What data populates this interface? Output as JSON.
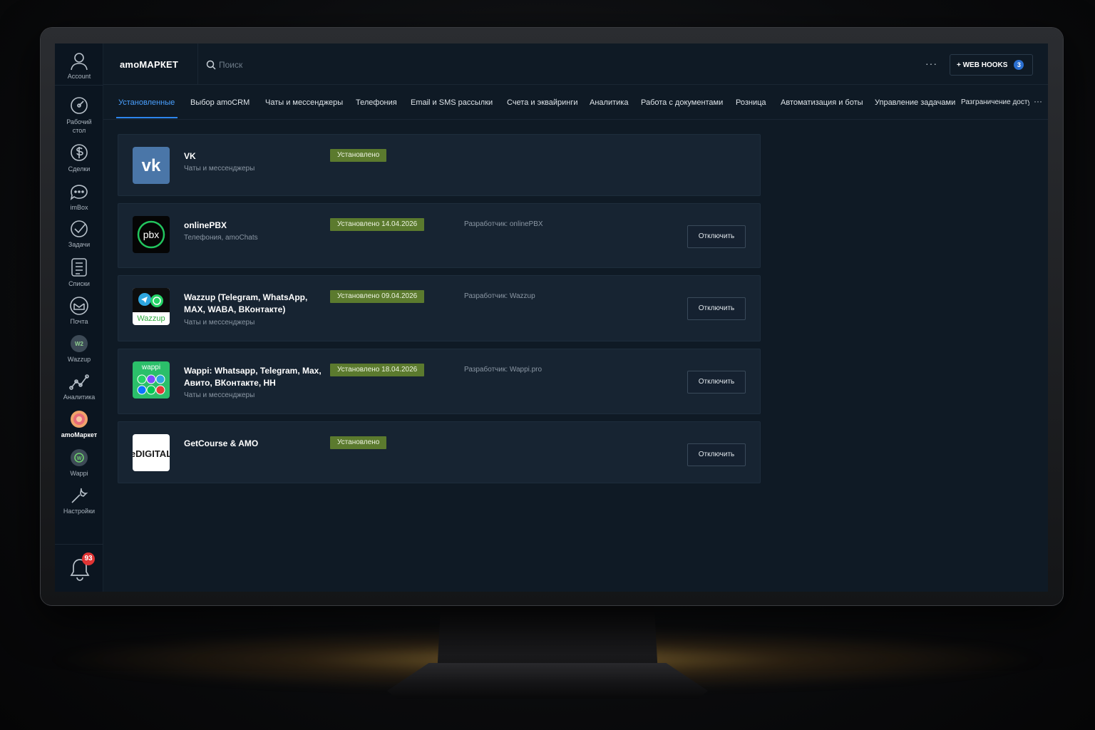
{
  "app": {
    "title": "amoМАРКЕТ",
    "search_placeholder": "Поиск",
    "more": "···",
    "webhooks_label": "+ WEB HOOKS",
    "webhooks_count": "3"
  },
  "sidebar": {
    "account": "Account",
    "items": [
      {
        "label": "Рабочий стол",
        "icon": "dashboard-gauge-icon"
      },
      {
        "label": "Сделки",
        "icon": "deals-dollar-icon"
      },
      {
        "label": "imBox",
        "icon": "chat-bubble-icon"
      },
      {
        "label": "Задачи",
        "icon": "tasks-check-icon"
      },
      {
        "label": "Списки",
        "icon": "lists-icon"
      },
      {
        "label": "Почта",
        "icon": "mail-icon"
      },
      {
        "label": "Wazzup",
        "icon": "wazzup-icon"
      },
      {
        "label": "Аналитика",
        "icon": "analytics-icon"
      },
      {
        "label": "amoМаркет",
        "icon": "amomarket-icon"
      },
      {
        "label": "Wappi",
        "icon": "wappi-icon"
      },
      {
        "label": "Настройки",
        "icon": "settings-wrench-icon"
      }
    ],
    "notifications_count": "93"
  },
  "tabs": [
    {
      "label": "Установленные",
      "active": true
    },
    {
      "label": "Выбор amoCRM"
    },
    {
      "label": "Чаты и мессенджеры"
    },
    {
      "label": "Телефония"
    },
    {
      "label": "Email и SMS рассылки"
    },
    {
      "label": "Счета и эквайринги"
    },
    {
      "label": "Аналитика"
    },
    {
      "label": "Работа с документами"
    },
    {
      "label": "Розница"
    },
    {
      "label": "Автоматизация и боты"
    },
    {
      "label": "Управление задачами"
    },
    {
      "label": "Разграничение доступа"
    }
  ],
  "tabs_more": "···",
  "integrations": [
    {
      "name": "VK",
      "category": "Чаты и мессенджеры",
      "status": "Установлено",
      "developer": "",
      "action": ""
    },
    {
      "name": "onlinePBX",
      "category": "Телефония, amoChats",
      "status": "Установлено 14.04.2026",
      "developer": "Разработчик: onlinePBX",
      "action": "Отключить",
      "logo_text": "pbx"
    },
    {
      "name": "Wazzup (Telegram, WhatsApp, MAX, WABA, ВКонтакте)",
      "category": "Чаты и мессенджеры",
      "status": "Установлено 09.04.2026",
      "developer": "Разработчик: Wazzup",
      "action": "Отключить",
      "logo_text": "Wazzup"
    },
    {
      "name": "Wappi: Whatsapp, Telegram, Max, Авито, ВКонтакте, HH",
      "category": "Чаты и мессенджеры",
      "status": "Установлено 18.04.2026",
      "developer": "Разработчик: Wappi.pro",
      "action": "Отключить",
      "logo_text": "wappi"
    },
    {
      "name": "GetCourse & AMO",
      "category": "",
      "status": "Установлено",
      "developer": "",
      "action": "Отключить",
      "logo_text": "eDIGITAL"
    }
  ]
}
